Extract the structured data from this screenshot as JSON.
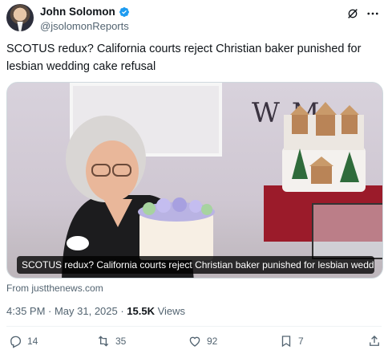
{
  "author": {
    "display_name": "John Solomon",
    "handle": "@jsolomonReports",
    "verified": true
  },
  "tweet": {
    "text": "SCOTUS redux? California courts reject Christian baker punished for lesbian wedding cake refusal"
  },
  "media": {
    "caption": "SCOTUS redux? California courts reject Christian baker punished for lesbian wedding ...",
    "wall_text": "W M"
  },
  "source": {
    "label": "From justthenews.com"
  },
  "meta": {
    "time_date": "4:35 PM · May 31, 2025 · ",
    "views_count": "15.5K",
    "views_label": " Views"
  },
  "actions": {
    "replies": "14",
    "reposts": "35",
    "likes": "92",
    "bookmarks": "7"
  },
  "colors": {
    "text": "#0f1419",
    "secondary": "#536471",
    "verified": "#1d9bf0"
  }
}
